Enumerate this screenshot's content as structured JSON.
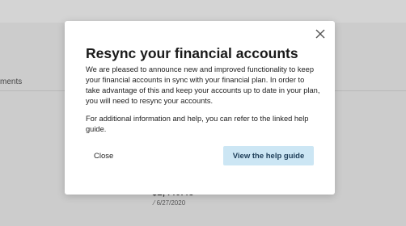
{
  "background": {
    "tab_label_partial": "ments",
    "value_partial": "$2,440.43",
    "date": "6/27/2020"
  },
  "modal": {
    "title": "Resync your financial accounts",
    "paragraph_1": "We are pleased to announce new and improved functionality to keep your financial accounts in sync with your financial plan. In order to take advantage of this and keep your accounts up to date in your plan, you will need to resync your accounts.",
    "paragraph_2": "For additional information and help, you can refer to the linked help guide.",
    "close_label": "Close",
    "help_button_label": "View the help guide",
    "close_icon": "close-icon"
  },
  "colors": {
    "help_button_bg": "#cce6f4",
    "help_button_text": "#1c3c57"
  }
}
